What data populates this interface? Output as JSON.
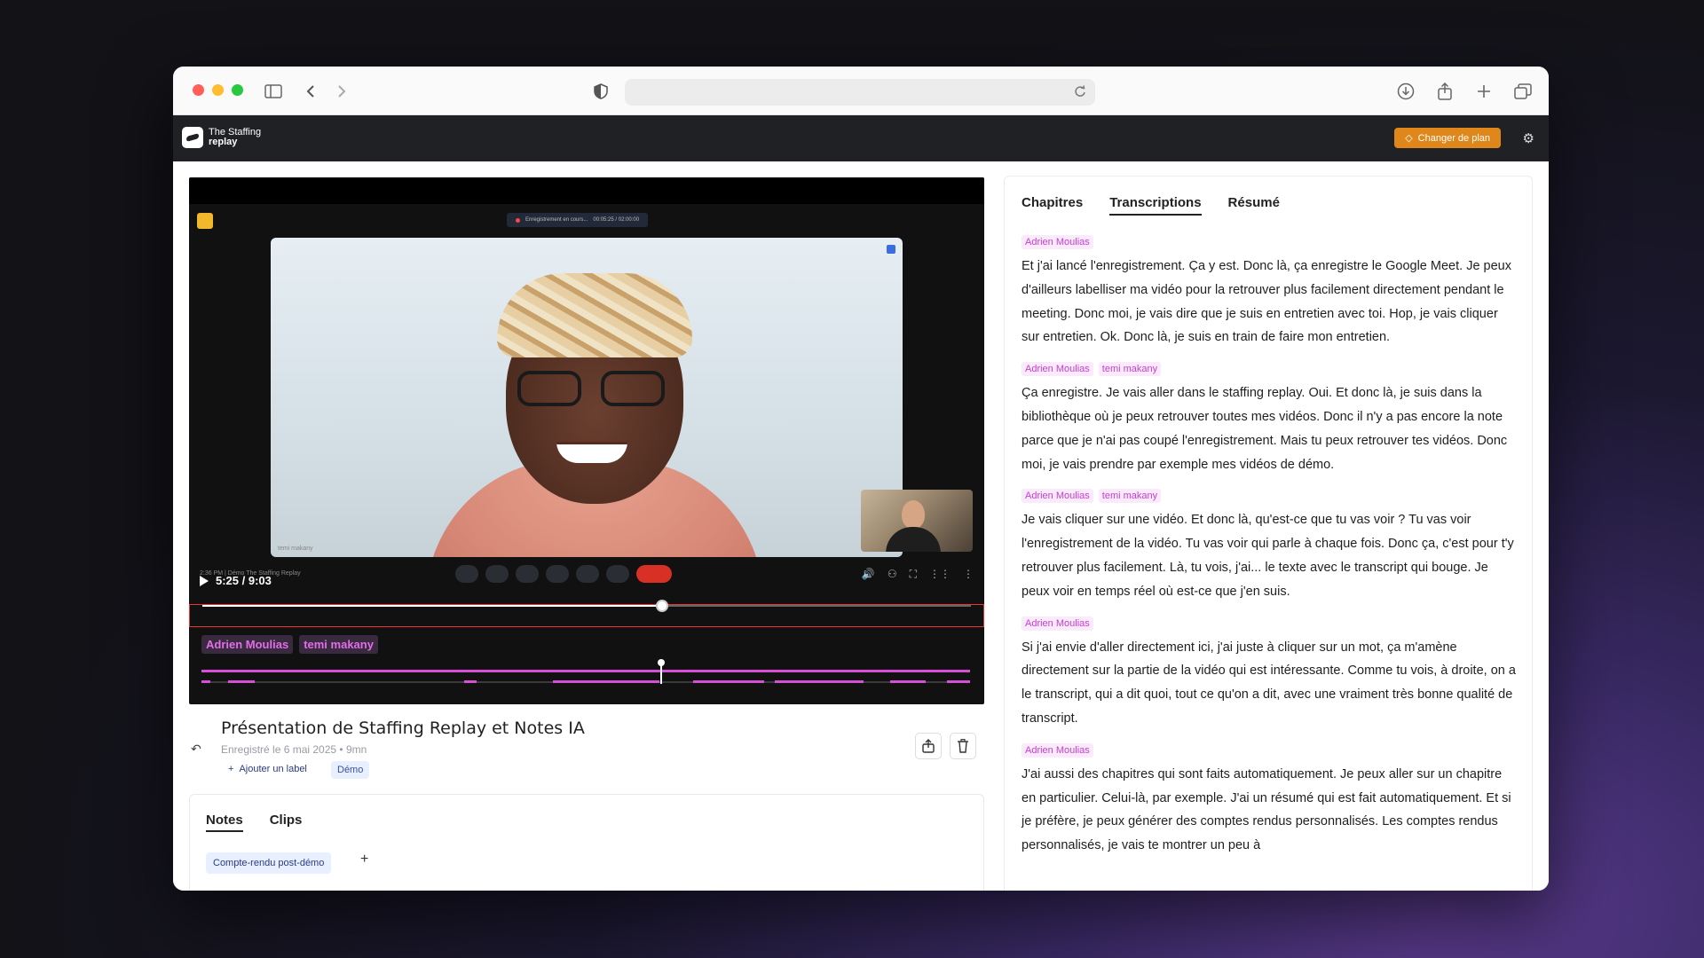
{
  "browser": {
    "address": ""
  },
  "app": {
    "logo_line1": "The Staffing",
    "logo_line2": "replay",
    "plan_button": "Changer de plan"
  },
  "player": {
    "recording_status": "Enregistrement en cours...",
    "recording_timer": "00:05:25 / 02:00:00",
    "meet_info": "2:36 PM  |  Démo The Staffing Replay",
    "participant_label": "temi makany",
    "time": "5:25 / 9:03",
    "progress": 0.598,
    "speakers": [
      "Adrien Moulias",
      "temi makany"
    ]
  },
  "recording": {
    "title": "Présentation de Staffing Replay et Notes IA",
    "subtitle": "Enregistré le 6 mai 2025  •  9mn",
    "add_label": "Ajouter un label",
    "label_chip": "Démo"
  },
  "notes": {
    "tabs": [
      "Notes",
      "Clips"
    ],
    "chip": "Compte-rendu post-démo",
    "add": "+"
  },
  "side": {
    "tabs": [
      "Chapitres",
      "Transcriptions",
      "Résumé"
    ],
    "active_tab": "Transcriptions",
    "blocks": [
      {
        "tags": [
          "Adrien Moulias"
        ],
        "text": "Et j'ai lancé l'enregistrement. Ça y est. Donc là, ça enregistre le Google Meet. Je peux d'ailleurs labelliser ma vidéo pour la retrouver plus facilement directement pendant le meeting. Donc moi, je vais dire que je suis en entretien avec toi. Hop, je vais cliquer sur entretien. Ok. Donc là, je suis en train de faire mon entretien."
      },
      {
        "tags": [
          "Adrien Moulias",
          "temi makany"
        ],
        "text": "Ça enregistre. Je vais aller dans le staffing replay. Oui. Et donc là, je suis dans la bibliothèque où je peux retrouver toutes mes vidéos. Donc il n'y a pas encore la note parce que je n'ai pas coupé l'enregistrement. Mais tu peux retrouver tes vidéos. Donc moi, je vais prendre par exemple mes vidéos de démo."
      },
      {
        "tags": [
          "Adrien Moulias",
          "temi makany"
        ],
        "text": "Je vais cliquer sur une vidéo. Et donc là, qu'est-ce que tu vas voir ? Tu vas voir l'enregistrement de la vidéo. Tu vas voir qui parle à chaque fois. Donc ça, c'est pour t'y retrouver plus facilement. Là, tu vois, j'ai... le texte avec le transcript qui bouge. Je peux voir en temps réel où est-ce que j'en suis."
      },
      {
        "tags": [
          "Adrien Moulias"
        ],
        "text": "Si j'ai envie d'aller directement ici, j'ai juste à cliquer sur un mot, ça m'amène directement sur la partie de la vidéo qui est intéressante. Comme tu vois, à droite, on a le transcript, qui a dit quoi, tout ce qu'on a dit, avec une vraiment très bonne qualité de transcript."
      },
      {
        "tags": [
          "Adrien Moulias"
        ],
        "text": "J'ai aussi des chapitres qui sont faits automatiquement. Je peux aller sur un chapitre en particulier. Celui-là, par exemple. J'ai un résumé qui est fait automatiquement. Et si je préfère, je peux générer des comptes rendus personnalisés. Les comptes rendus personnalisés, je vais te montrer un peu à"
      }
    ]
  }
}
